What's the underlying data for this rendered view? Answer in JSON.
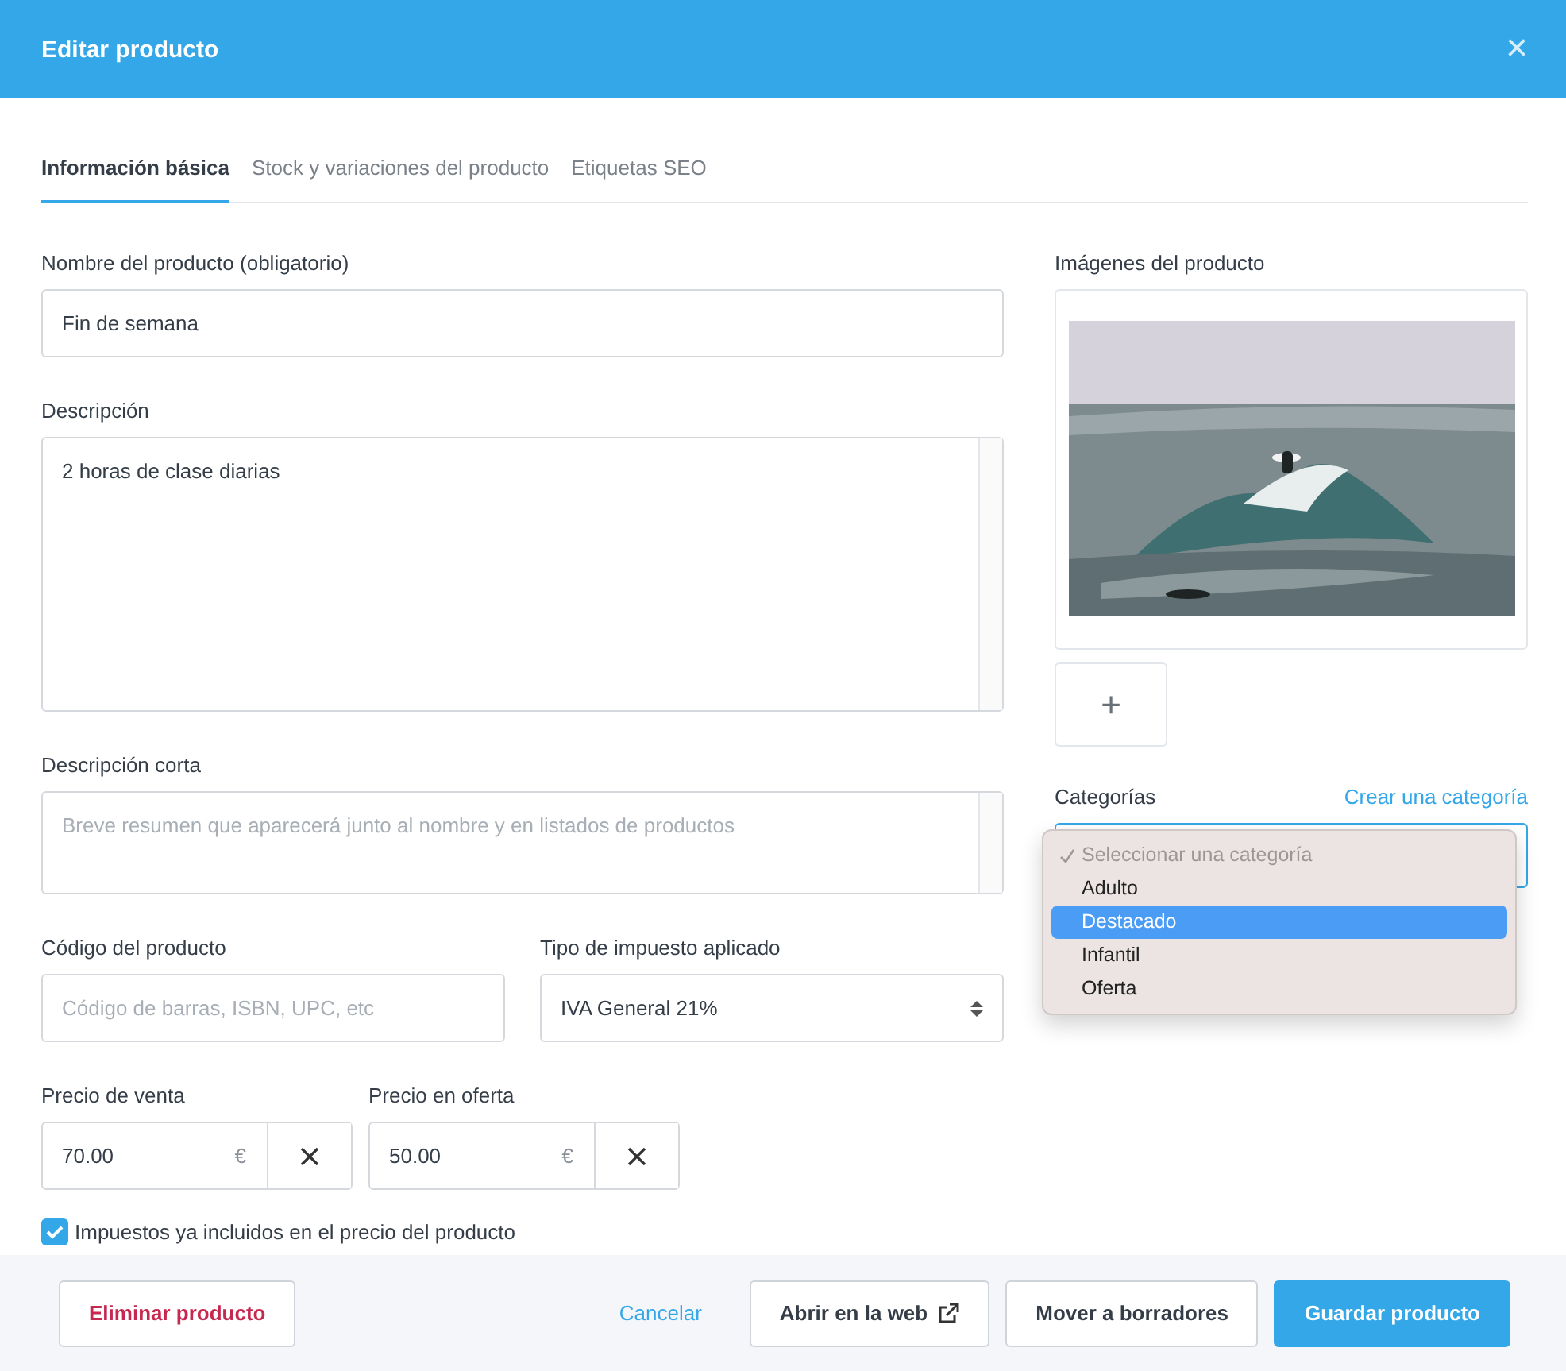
{
  "header": {
    "title": "Editar producto",
    "close": "×"
  },
  "tabs": [
    {
      "label": "Información básica",
      "selected": true
    },
    {
      "label": "Stock y variaciones del producto",
      "selected": false
    },
    {
      "label": "Etiquetas SEO",
      "selected": false
    }
  ],
  "name_field": {
    "label": "Nombre del producto (obligatorio)",
    "value": "Fin de semana"
  },
  "description": {
    "label": "Descripción",
    "value": "2 horas de clase diarias"
  },
  "short_description": {
    "label": "Descripción corta",
    "placeholder": "Breve resumen que aparecerá junto al nombre y en listados de productos"
  },
  "code_field": {
    "label": "Código del producto",
    "placeholder": "Código de barras, ISBN, UPC, etc"
  },
  "tax_field": {
    "label": "Tipo de impuesto aplicado",
    "value": "IVA General 21%"
  },
  "prices": [
    {
      "label": "Precio de venta",
      "value": "70.00",
      "currency": "€"
    },
    {
      "label": "Precio en oferta",
      "value": "50.00",
      "currency": "€"
    }
  ],
  "tax_included": {
    "label": "Impuestos ya incluidos en el precio del producto",
    "checked": true
  },
  "images": {
    "label": "Imágenes del producto",
    "add": "+"
  },
  "categories": {
    "label": "Categorías",
    "create_link": "Crear una categoría",
    "options": [
      {
        "label": "Seleccionar una categoría",
        "checked": true,
        "disabled": true,
        "selected": false
      },
      {
        "label": "Adulto",
        "checked": false,
        "disabled": false,
        "selected": false
      },
      {
        "label": "Destacado",
        "checked": false,
        "disabled": false,
        "selected": true
      },
      {
        "label": "Infantil",
        "checked": false,
        "disabled": false,
        "selected": false
      },
      {
        "label": "Oferta",
        "checked": false,
        "disabled": false,
        "selected": false
      }
    ]
  },
  "footer": {
    "delete": "Eliminar producto",
    "cancel": "Cancelar",
    "open_web": "Abrir en la web",
    "drafts": "Mover a borradores",
    "save": "Guardar producto"
  }
}
